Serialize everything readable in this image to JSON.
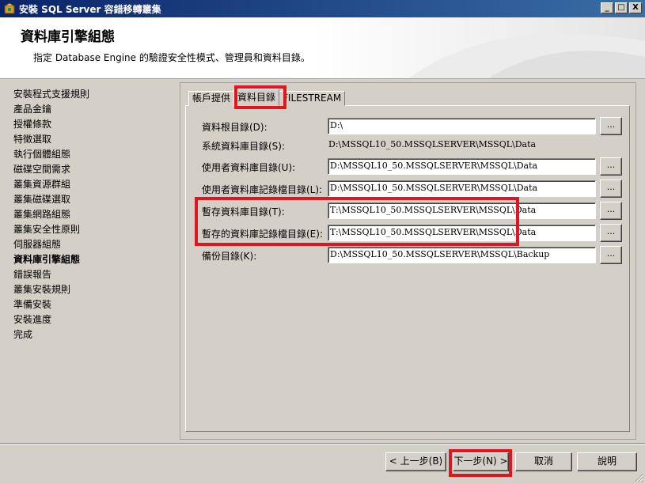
{
  "window": {
    "title": "安裝 SQL Server 容錯移轉叢集",
    "minimize": "_",
    "maximize": "□",
    "close": "X"
  },
  "header": {
    "title": "資料庫引擎組態",
    "subtitle": "指定 Database Engine 的驗證安全性模式、管理員和資料目錄。"
  },
  "nav": {
    "items": [
      {
        "label": "安裝程式支援規則"
      },
      {
        "label": "產品金鑰"
      },
      {
        "label": "授權條款"
      },
      {
        "label": "特徵選取"
      },
      {
        "label": "執行個體組態"
      },
      {
        "label": "磁碟空間需求"
      },
      {
        "label": "叢集資源群組"
      },
      {
        "label": "叢集磁碟選取"
      },
      {
        "label": "叢集網路組態"
      },
      {
        "label": "叢集安全性原則"
      },
      {
        "label": "伺服器組態"
      },
      {
        "label": "資料庫引擎組態",
        "active": true
      },
      {
        "label": "錯誤報告"
      },
      {
        "label": "叢集安裝規則"
      },
      {
        "label": "準備安裝"
      },
      {
        "label": "安裝進度"
      },
      {
        "label": "完成"
      }
    ]
  },
  "tabs": [
    {
      "label": "帳戶提供"
    },
    {
      "label": "資料目錄",
      "active": true
    },
    {
      "label": "FILESTREAM"
    }
  ],
  "fields": {
    "data_root": {
      "label": "資料根目錄(D):",
      "value": "D:\\",
      "browse": "..."
    },
    "system_db": {
      "label": "系統資料庫目錄(S):",
      "value": "D:\\MSSQL10_50.MSSQLSERVER\\MSSQL\\Data"
    },
    "user_db": {
      "label": "使用者資料庫目錄(U):",
      "value": "D:\\MSSQL10_50.MSSQLSERVER\\MSSQL\\Data",
      "browse": "..."
    },
    "user_log": {
      "label": "使用者資料庫記錄檔目錄(L):",
      "value": "D:\\MSSQL10_50.MSSQLSERVER\\MSSQL\\Data",
      "browse": "..."
    },
    "temp_db": {
      "label": "暫存資料庫目錄(T):",
      "value": "T:\\MSSQL10_50.MSSQLSERVER\\MSSQL\\Data",
      "browse": "..."
    },
    "temp_log": {
      "label": "暫存的資料庫記錄檔目錄(E):",
      "value": "T:\\MSSQL10_50.MSSQLSERVER\\MSSQL\\Data",
      "browse": "..."
    },
    "backup": {
      "label": "備份目錄(K):",
      "value": "D:\\MSSQL10_50.MSSQLSERVER\\MSSQL\\Backup",
      "browse": "..."
    }
  },
  "buttons": {
    "back": "< 上一步(B)",
    "next": "下一步(N) >",
    "cancel": "取消",
    "help": "說明"
  },
  "colors": {
    "highlight": "#e0151f",
    "titlebar_start": "#0a246a",
    "titlebar_end": "#3a6ea5",
    "face": "#d4d0c8"
  }
}
